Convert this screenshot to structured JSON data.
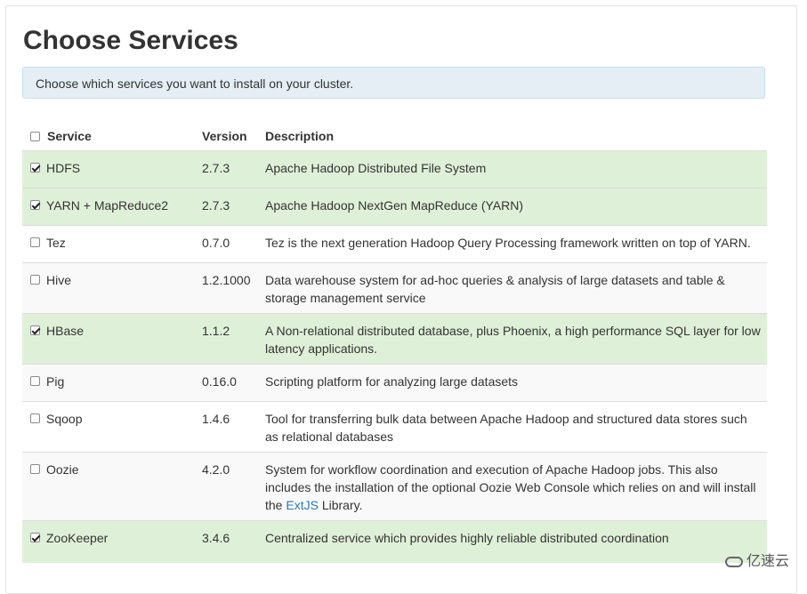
{
  "page": {
    "title": "Choose Services",
    "info": "Choose which services you want to install on your cluster."
  },
  "table": {
    "headers": {
      "service": "Service",
      "version": "Version",
      "description": "Description"
    },
    "rows": [
      {
        "service": "HDFS",
        "version": "2.7.3",
        "description": "Apache Hadoop Distributed File System",
        "checked": true
      },
      {
        "service": "YARN + MapReduce2",
        "version": "2.7.3",
        "description": "Apache Hadoop NextGen MapReduce (YARN)",
        "checked": true
      },
      {
        "service": "Tez",
        "version": "0.7.0",
        "description": "Tez is the next generation Hadoop Query Processing framework written on top of YARN.",
        "checked": false
      },
      {
        "service": "Hive",
        "version": "1.2.1000",
        "description": "Data warehouse system for ad-hoc queries & analysis of large datasets and table & storage management service",
        "checked": false
      },
      {
        "service": "HBase",
        "version": "1.1.2",
        "description": "A Non-relational distributed database, plus Phoenix, a high performance SQL layer for low latency applications.",
        "checked": true
      },
      {
        "service": "Pig",
        "version": "0.16.0",
        "description": "Scripting platform for analyzing large datasets",
        "checked": false
      },
      {
        "service": "Sqoop",
        "version": "1.4.6",
        "description": "Tool for transferring bulk data between Apache Hadoop and structured data stores such as relational databases",
        "checked": false
      },
      {
        "service": "Oozie",
        "version": "4.2.0",
        "description_before": "System for workflow coordination and execution of Apache Hadoop jobs. This also includes the installation of the optional Oozie Web Console which relies on and will install the ",
        "description_link": "ExtJS",
        "description_after": " Library.",
        "checked": false
      },
      {
        "service": "ZooKeeper",
        "version": "3.4.6",
        "description": "Centralized service which provides highly reliable distributed coordination",
        "checked": true
      }
    ]
  },
  "watermark": "亿速云"
}
